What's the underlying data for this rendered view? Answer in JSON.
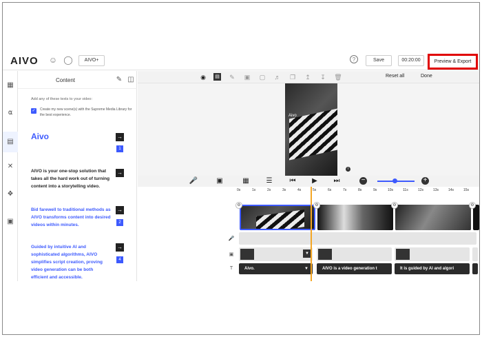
{
  "header": {
    "logo": "AIVO",
    "plan_label": "AIVO+",
    "save_label": "Save",
    "duration": "00:20:00",
    "preview_export_label": "Preview & Export"
  },
  "rail": {
    "items": [
      "layout",
      "audio",
      "content",
      "tools",
      "tags",
      "media"
    ]
  },
  "panel": {
    "title": "Content",
    "hint": "Add any of these texts to your video:",
    "checkbox_label": "Create my new scene(s) with the Supreme Media Library for the best experience.",
    "scenes": [
      {
        "text": "Aivo",
        "number": "1"
      },
      {
        "text": "AIVO is your one-stop solution that takes all the hard work out of turning content into a storytelling video.",
        "number": ""
      },
      {
        "text": "Bid farewell to traditional methods as AIVO transforms content into desired videos within minutes.",
        "number": "2"
      },
      {
        "text": "Guided by intuitive AI and sophisticated algorithms, AIVO simplifies script creation, proving video generation can be both efficient and accessible.",
        "number": "4"
      }
    ]
  },
  "editbar": {
    "reset_all": "Reset all",
    "done": "Done"
  },
  "preview": {
    "watermark": "Aivo"
  },
  "ruler": {
    "ticks": [
      "0s",
      "1s",
      "2s",
      "3s",
      "4s",
      "5s",
      "6s",
      "7s",
      "8s",
      "9s",
      "10s",
      "11s",
      "12s",
      "13s",
      "14s",
      "15s"
    ]
  },
  "timeline": {
    "text_clips": [
      "Aivo.",
      "AIVO is a video generation t",
      "It is guided by AI and algori"
    ]
  },
  "colors": {
    "accent": "#3d5afe",
    "highlight": "#e00000",
    "playhead": "#f5a623"
  }
}
